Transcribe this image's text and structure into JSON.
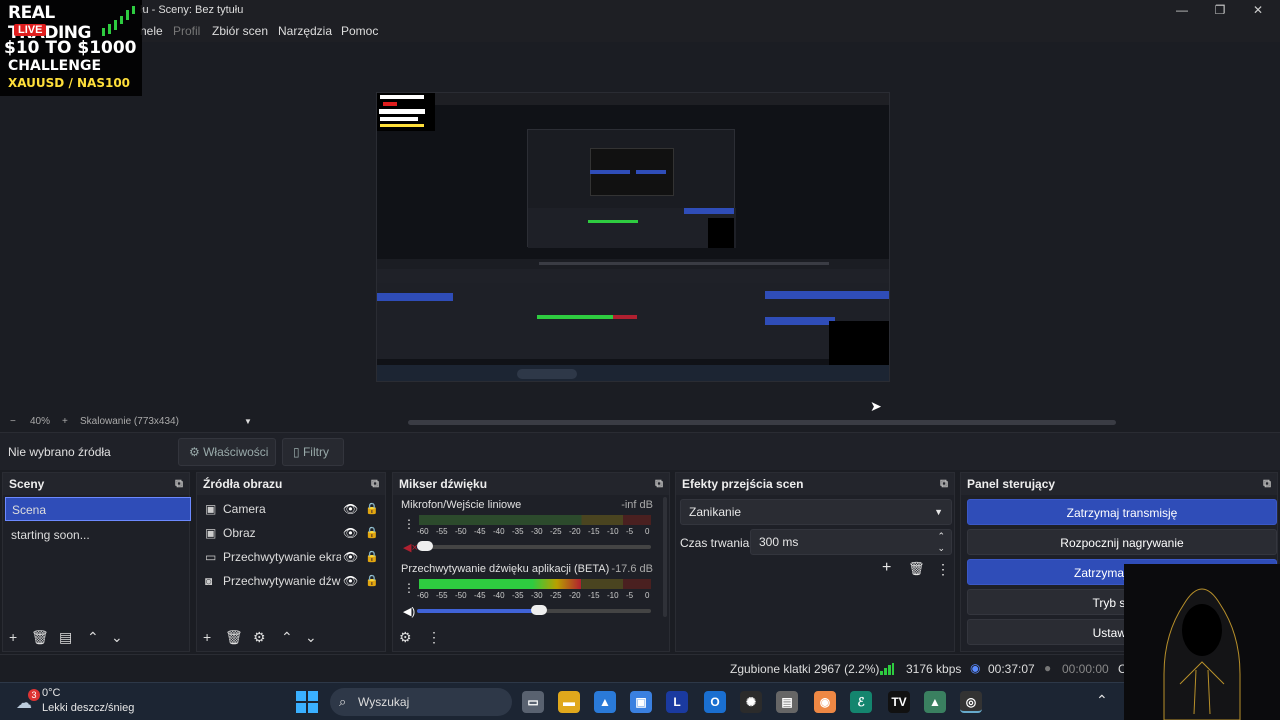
{
  "window": {
    "title": "łu - Sceny: Bez tytułu",
    "minimize": "—",
    "maximize": "❐",
    "close": "✕"
  },
  "menu": {
    "items": [
      "nele",
      "Profil",
      "Zbiór scen",
      "Narzędzia",
      "Pomoc"
    ]
  },
  "overlay_logo": {
    "line1": "REAL TRADING",
    "live": "LIVE",
    "line2": "$10 TO $1000",
    "line3": "CHALLENGE",
    "line4": "XAUUSD / NAS100"
  },
  "zoom": {
    "minus": "−",
    "value": "40%",
    "plus": "+",
    "scaling": "Skalowanie (773x434)",
    "dropdown": "▼"
  },
  "source_toolbar": {
    "no_source": "Nie wybrano źródła",
    "properties": "Właściwości",
    "filters": "Filtry"
  },
  "scenes": {
    "title": "Sceny",
    "items": [
      "Scena",
      "starting soon..."
    ]
  },
  "sources": {
    "title": "Źródła obrazu",
    "items": [
      "Camera",
      "Obraz",
      "Przechwytywanie ekranu",
      "Przechwytywanie dźwięku"
    ]
  },
  "mixer": {
    "title": "Mikser dźwięku",
    "channels": [
      {
        "name": "Mikrofon/Wejście liniowe",
        "db": "-inf dB",
        "level": 0.0,
        "volume": 0.03
      },
      {
        "name": "Przechwytywanie dźwięku aplikacji (BETA)",
        "db": "-17.6 dB",
        "level": 0.7,
        "volume": 0.52
      }
    ],
    "scale": [
      "-60",
      "-55",
      "-50",
      "-45",
      "-40",
      "-35",
      "-30",
      "-25",
      "-20",
      "-15",
      "-10",
      "-5",
      "0"
    ]
  },
  "transitions": {
    "title": "Efekty przejścia scen",
    "selected": "Zanikanie",
    "duration_label": "Czas trwania",
    "duration_value": "300 ms"
  },
  "controls": {
    "title": "Panel sterujący",
    "buttons": [
      "Zatrzymaj transmisję",
      "Rozpocznij nagrywanie",
      "Zatrzymaj kamerę",
      "Tryb studia",
      "Ustawienia"
    ]
  },
  "status": {
    "dropped": "Zgubione klatki 2967 (2.2%)",
    "bitrate": "3176 kbps",
    "stream_time": "00:37:07",
    "rec_time": "00:00:00",
    "cut": "C"
  },
  "taskbar": {
    "weather_temp": "0°C",
    "weather_desc": "Lekki deszcz/śnieg",
    "weather_badge": "3",
    "search": "Wyszukaj"
  },
  "colors": {
    "accent": "#2f4db8",
    "meter_green": "#2ecc40",
    "meter_yellow": "#b8a000",
    "meter_red": "#b02030"
  }
}
